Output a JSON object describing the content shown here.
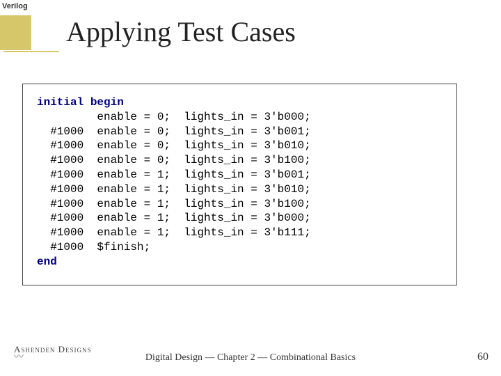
{
  "tab": "Verilog",
  "title": "Applying Test Cases",
  "footer": "Digital Design — Chapter 2 — Combinational Basics",
  "page_number": "60",
  "logo_text": "Ashenden Designs",
  "code": {
    "kw_initial": "initial",
    "kw_begin": "begin",
    "kw_end": "end",
    "lines": [
      "         enable = 0;  lights_in = 3'b000;",
      "  #1000  enable = 0;  lights_in = 3'b001;",
      "  #1000  enable = 0;  lights_in = 3'b010;",
      "  #1000  enable = 0;  lights_in = 3'b100;",
      "  #1000  enable = 1;  lights_in = 3'b001;",
      "  #1000  enable = 1;  lights_in = 3'b010;",
      "  #1000  enable = 1;  lights_in = 3'b100;",
      "  #1000  enable = 1;  lights_in = 3'b000;",
      "  #1000  enable = 1;  lights_in = 3'b111;",
      "  #1000  $finish;"
    ]
  }
}
